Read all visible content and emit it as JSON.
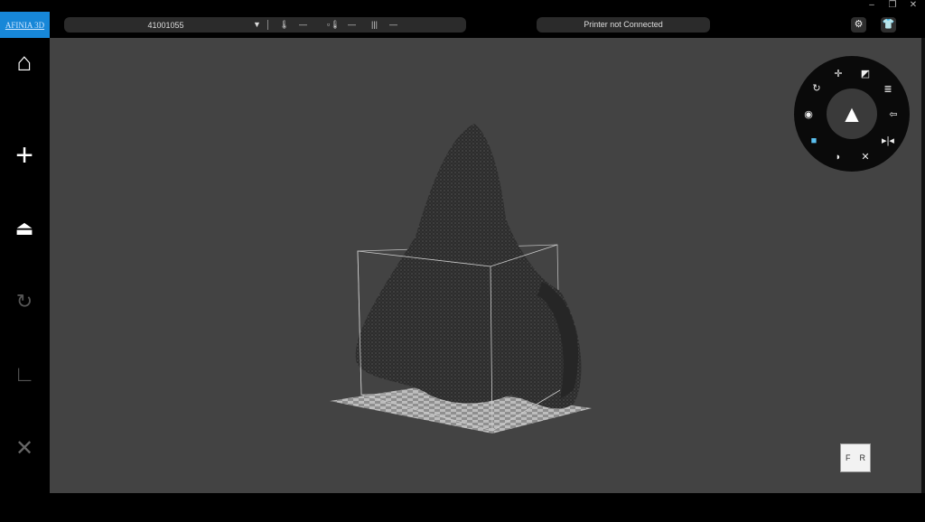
{
  "window": {
    "minimize": "–",
    "restore": "❐",
    "close": "✕"
  },
  "logo": "AFINIA 3D",
  "status": {
    "serial": "41001055",
    "dropdown": "▼",
    "nozzle_temp": "—",
    "bed_temp": "—",
    "material": "—"
  },
  "printer_status": "Printer not Connected",
  "top_icons": [
    "settings-icon",
    "shirt-icon"
  ],
  "sidebar": [
    "home-icon",
    "add-icon",
    "print-icon",
    "calibrate-icon",
    "measure-icon",
    "tools-icon"
  ],
  "wheel": {
    "items": [
      "move-icon",
      "scale-icon",
      "layers-icon",
      "undo-icon",
      "mirror-icon",
      "shrink-icon",
      "support-icon",
      "cube-view-icon",
      "eye-icon",
      "rotate-icon"
    ]
  },
  "view_cube": {
    "front": "F",
    "right": "R"
  },
  "colors": {
    "accent": "#1787d8",
    "viewport": "#434343"
  }
}
